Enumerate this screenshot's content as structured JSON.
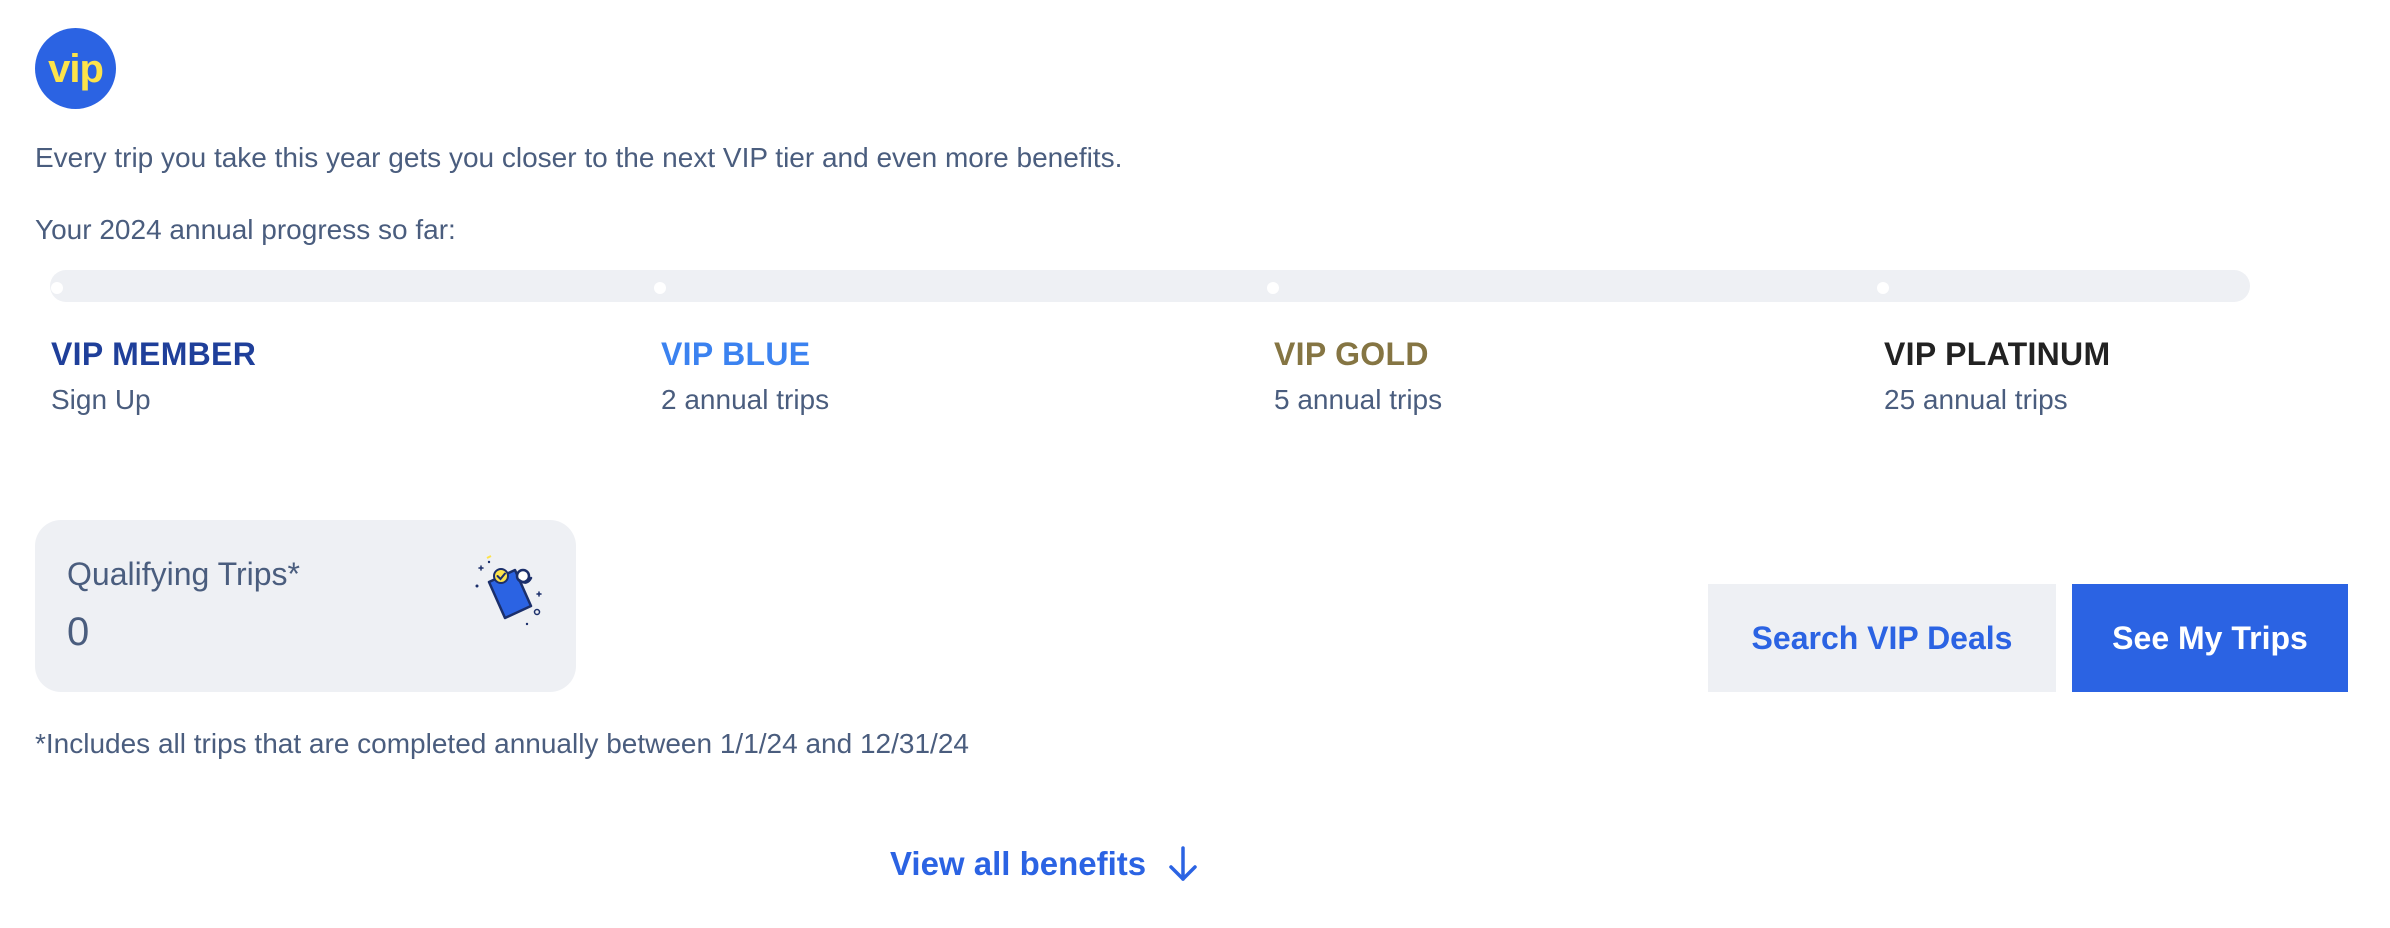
{
  "logo": {
    "text": "vip",
    "bg_color": "#2b63e3",
    "text_color": "#fde34a"
  },
  "intro_text": "Every trip you take this year gets you closer to the next VIP tier and even more benefits.",
  "progress": {
    "label": "Your 2024 annual progress so far:",
    "fill_fraction": 0
  },
  "tiers": [
    {
      "name": "VIP MEMBER",
      "requirement": "Sign Up",
      "color": "#1f3f9a"
    },
    {
      "name": "VIP BLUE",
      "requirement": "2 annual trips",
      "color": "#3b82f0"
    },
    {
      "name": "VIP GOLD",
      "requirement": "5 annual trips",
      "color": "#857543"
    },
    {
      "name": "VIP PLATINUM",
      "requirement": "25 annual trips",
      "color": "#222222"
    }
  ],
  "qualifying_trips": {
    "label": "Qualifying Trips*",
    "value": "0",
    "icon": "luggage-tag-icon"
  },
  "footnote": "*Includes all trips that are completed annually between 1/1/24 and 12/31/24",
  "buttons": {
    "search_deals": "Search VIP Deals",
    "see_trips": "See My Trips"
  },
  "view_benefits": {
    "label": "View all benefits",
    "icon": "arrow-down-icon"
  },
  "colors": {
    "accent": "#2b63e3",
    "card_bg": "#eef0f4",
    "text": "#4a5d7e"
  }
}
